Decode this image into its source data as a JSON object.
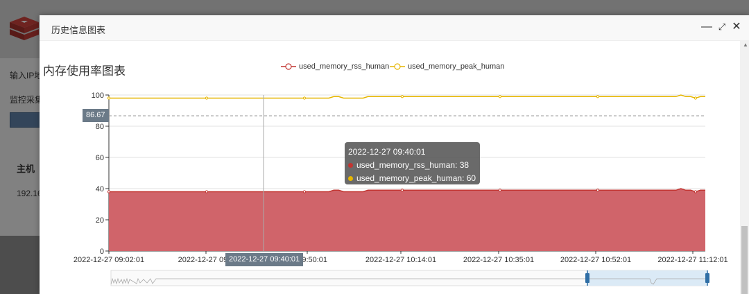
{
  "background": {
    "label_ip": "输入IP地",
    "label_monitor": "监控采集",
    "table_header_host": "主机",
    "table_row_ip": "192.16"
  },
  "dialog": {
    "title": "历史信息图表",
    "buttons": {
      "minimize": "—",
      "maximize": "⤢",
      "close": "✕"
    }
  },
  "chart": {
    "title": "内存使用率图表",
    "tooltip": {
      "time": "2022-12-27 09:40:01",
      "rows": [
        {
          "label": "used_memory_rss_human: 38",
          "color": "#c23531"
        },
        {
          "label": "used_memory_peak_human: 60",
          "color": "#e6b600"
        }
      ]
    },
    "axis_pointer": {
      "x_label": "2022-12-27 09:40:01",
      "y_label": "86.67"
    }
  },
  "chart_data": {
    "type": "area",
    "y_axis": {
      "min": 0,
      "max": 100,
      "ticks": [
        0,
        20,
        40,
        60,
        80,
        100
      ]
    },
    "x_tick_labels": [
      "2022-12-27 09:02:01",
      "2022-12-27 09:2",
      "27 09:50:01",
      "2022-12-27 10:14:01",
      "2022-12-27 10:35:01",
      "2022-12-27 10:52:01",
      "2022-12-27 11:12:01"
    ],
    "grid": true,
    "legend_position": "top-center",
    "series": [
      {
        "name": "used_memory_rss_human",
        "color": "#c23531",
        "fill": "#d0646a",
        "values": [
          38,
          38,
          38,
          38,
          38,
          38,
          38,
          38,
          38,
          38,
          38,
          38,
          38,
          38,
          38,
          38,
          38,
          38,
          38,
          38,
          38,
          38,
          38,
          38,
          38,
          38,
          38,
          38,
          38,
          38,
          38,
          38,
          38,
          38,
          38,
          38,
          38,
          38,
          38,
          38,
          38,
          38,
          38,
          38,
          38,
          38,
          39,
          39,
          38,
          38,
          38,
          38,
          38,
          39,
          39,
          39,
          39,
          39,
          39,
          39,
          39,
          39,
          39,
          39,
          39,
          39,
          39,
          39,
          39,
          39,
          39,
          39,
          39,
          39,
          39,
          39,
          39,
          39,
          39,
          39,
          39,
          39,
          39,
          39,
          39,
          39,
          39,
          39,
          39,
          39,
          39,
          39,
          39,
          39,
          39,
          39,
          39,
          39,
          39,
          39,
          39,
          39,
          39,
          39,
          39,
          39,
          39,
          39,
          39,
          39,
          39,
          39,
          39,
          39,
          39,
          39,
          39,
          40,
          39,
          39,
          38,
          39,
          39
        ]
      },
      {
        "name": "used_memory_peak_human",
        "color": "#e6b600",
        "values": [
          98,
          98,
          98,
          98,
          98,
          98,
          98,
          98,
          98,
          98,
          98,
          98,
          98,
          98,
          98,
          98,
          98,
          98,
          98,
          98,
          98,
          98,
          98,
          98,
          98,
          98,
          98,
          98,
          98,
          98,
          98,
          98,
          98,
          98,
          98,
          98,
          98,
          98,
          98,
          98,
          98,
          98,
          98,
          98,
          98,
          98,
          99,
          99,
          98,
          98,
          98,
          98,
          98,
          99,
          99,
          99,
          99,
          99,
          99,
          99,
          99,
          99,
          99,
          99,
          99,
          99,
          99,
          99,
          99,
          99,
          99,
          99,
          99,
          99,
          99,
          99,
          99,
          99,
          99,
          99,
          99,
          99,
          99,
          99,
          99,
          99,
          99,
          99,
          99,
          99,
          99,
          99,
          99,
          99,
          99,
          99,
          99,
          99,
          99,
          99,
          99,
          99,
          99,
          99,
          99,
          99,
          99,
          99,
          99,
          99,
          99,
          99,
          99,
          99,
          99,
          99,
          99,
          100,
          99,
          99,
          98,
          99,
          99
        ]
      }
    ]
  }
}
